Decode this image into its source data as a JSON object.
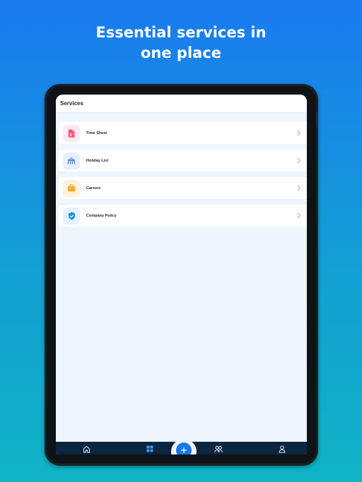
{
  "headline": {
    "line1": "Essential services in",
    "line2": "one place"
  },
  "app": {
    "header_title": "Services",
    "services": [
      {
        "label": "Time Sheet",
        "icon": "timesheet-icon",
        "icon_color": "#f0567a",
        "icon_bg": "#fde9ef"
      },
      {
        "label": "Holiday List",
        "icon": "holiday-icon",
        "icon_color": "#5b87d6",
        "icon_bg": "#e6eefb"
      },
      {
        "label": "Careers",
        "icon": "careers-icon",
        "icon_color": "#f4a51c",
        "icon_bg": "#fdf2dd"
      },
      {
        "label": "Company Policy",
        "icon": "policy-icon",
        "icon_color": "#1d8fe6",
        "icon_bg": "#e3f2fd"
      }
    ],
    "tabbar": {
      "items": [
        "home-icon",
        "services-icon",
        "add-icon",
        "team-icon",
        "profile-icon"
      ],
      "active": "services-icon",
      "active_color": "#3d9af2",
      "inactive_color": "#ffffff"
    }
  },
  "colors": {
    "background_top": "#1a7af0",
    "background_bottom": "#10b3c6",
    "fab": "#1877e8"
  }
}
